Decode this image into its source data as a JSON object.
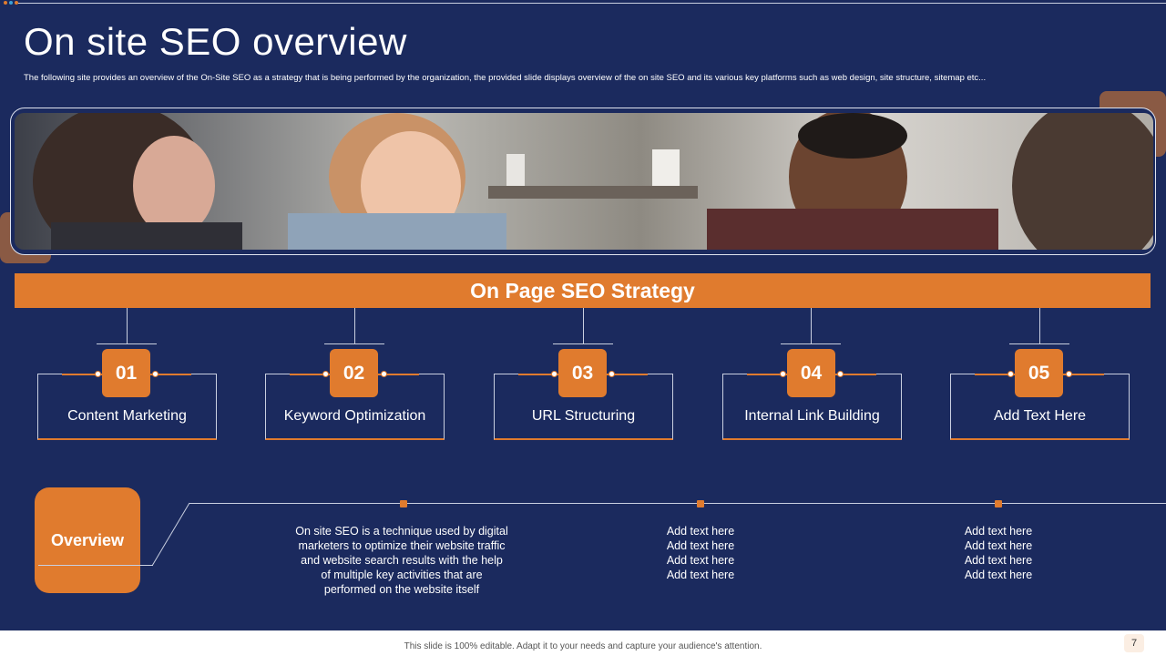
{
  "slide": {
    "title": "On site SEO overview",
    "subtitle": "The following site provides an overview of the On-Site SEO as a strategy that is being performed by the organization, the provided slide displays overview of the on site SEO and its various key platforms such as web design, site structure, sitemap etc...",
    "page_number": "7",
    "footer": "This slide is 100% editable. Adapt it to your needs and capture your audience's attention."
  },
  "strategy": {
    "heading": "On Page SEO Strategy",
    "items": [
      {
        "number": "01",
        "label": "Content Marketing"
      },
      {
        "number": "02",
        "label": "Keyword Optimization"
      },
      {
        "number": "03",
        "label": "URL Structuring"
      },
      {
        "number": "04",
        "label": "Internal  Link Building"
      },
      {
        "number": "05",
        "label": "Add Text Here"
      }
    ]
  },
  "overview": {
    "label": "Overview",
    "description": [
      "On site SEO is a technique used by digital",
      "marketers to optimize their website traffic",
      "and website search results with the help",
      "of multiple key activities that are",
      "performed  on the website itself"
    ],
    "col2": [
      "Add text here",
      "Add text here",
      "Add text here",
      "Add text here"
    ],
    "col3": [
      "Add text here",
      "Add text here",
      "Add text here",
      "Add text here"
    ]
  },
  "colors": {
    "background": "#1b2a5e",
    "accent": "#e07b2e",
    "deco": "#8a5a44"
  },
  "icons": {
    "photo": "team-meeting-photo"
  }
}
